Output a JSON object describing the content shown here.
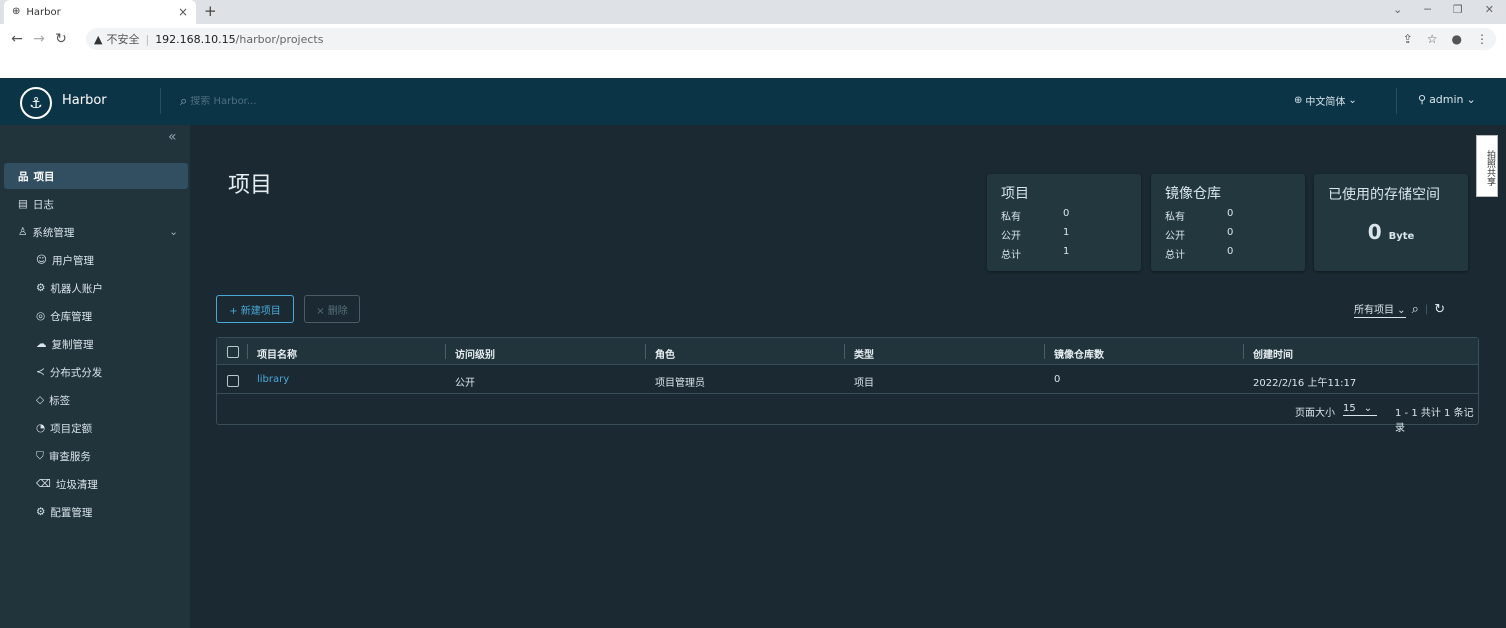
{
  "browser": {
    "tab_title": "Harbor",
    "tab_close": "×",
    "new_tab": "+",
    "security": "不安全",
    "url_host": "192.168.10.15",
    "url_path": "/harbor/projects"
  },
  "header": {
    "brand": "Harbor",
    "search_placeholder": "搜索 Harbor...",
    "language": "中文简体",
    "user": "admin"
  },
  "sidebar": {
    "items": [
      {
        "label": "项目"
      },
      {
        "label": "日志"
      },
      {
        "label": "系统管理"
      },
      {
        "label": "用户管理"
      },
      {
        "label": "机器人账户"
      },
      {
        "label": "仓库管理"
      },
      {
        "label": "复制管理"
      },
      {
        "label": "分布式分发"
      },
      {
        "label": "标签"
      },
      {
        "label": "项目定额"
      },
      {
        "label": "审查服务"
      },
      {
        "label": "垃圾清理"
      },
      {
        "label": "配置管理"
      }
    ]
  },
  "main": {
    "title": "项目",
    "side_tab": "拍照共享",
    "cards": {
      "projects": {
        "title": "项目",
        "rows": [
          {
            "label": "私有",
            "value": "0"
          },
          {
            "label": "公开",
            "value": "1"
          },
          {
            "label": "总计",
            "value": "1"
          }
        ]
      },
      "repos": {
        "title": "镜像仓库",
        "rows": [
          {
            "label": "私有",
            "value": "0"
          },
          {
            "label": "公开",
            "value": "0"
          },
          {
            "label": "总计",
            "value": "0"
          }
        ]
      },
      "storage": {
        "title": "已使用的存储空间",
        "value": "0",
        "unit": "Byte"
      }
    },
    "actions": {
      "new_project": "+ 新建项目",
      "delete": "× 删除"
    },
    "filter": {
      "selected": "所有项目"
    },
    "table": {
      "headers": [
        "项目名称",
        "访问级别",
        "角色",
        "类型",
        "镜像仓库数",
        "创建时间"
      ],
      "rows": [
        {
          "name": "library",
          "access": "公开",
          "role": "项目管理员",
          "type": "项目",
          "repo_count": "0",
          "created": "2022/2/16 上午11:17"
        }
      ],
      "page_size_label": "页面大小",
      "page_size": "15",
      "total": "1 - 1 共计 1 条记录"
    }
  }
}
